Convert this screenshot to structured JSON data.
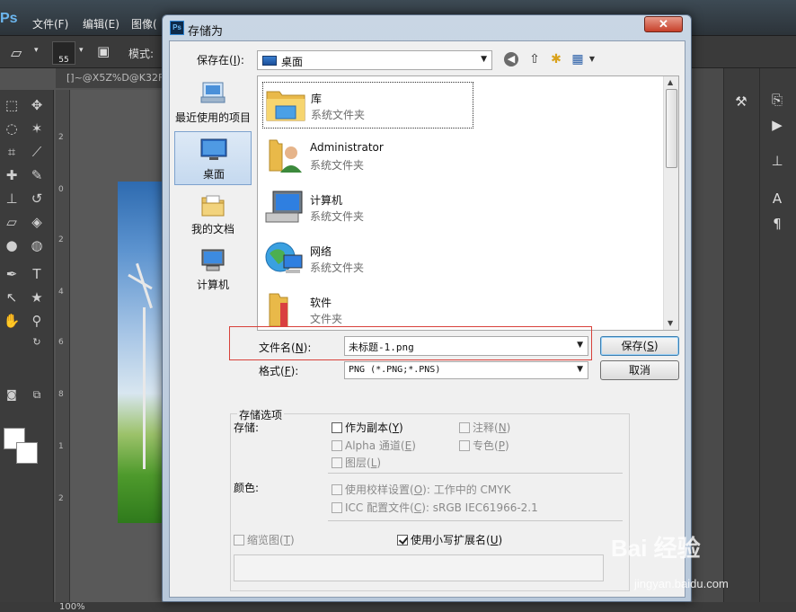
{
  "photoshop": {
    "logo": "Ps",
    "menu": [
      "文件(F)",
      "编辑(E)",
      "图像("
    ],
    "brush_size": "55",
    "mode_label": "模式:",
    "doc_tab": "[]~@X5Z%D@K32F",
    "ruler_numbers": [
      "2",
      "0",
      "2",
      "4",
      "6",
      "8",
      "1",
      "2"
    ],
    "status": "100%"
  },
  "dialog": {
    "title": "存储为",
    "close_glyph": "✕",
    "save_in_label": "保存在(I):",
    "save_in_label_prefix": "保存在(",
    "save_in_key": "I",
    "save_in_suffix": "):",
    "location": "桌面",
    "places": [
      {
        "label": "最近使用的项目",
        "icon": "recent-items-icon"
      },
      {
        "label": "桌面",
        "icon": "desktop-icon"
      },
      {
        "label": "我的文档",
        "icon": "documents-icon"
      },
      {
        "label": "计算机",
        "icon": "computer-icon"
      }
    ],
    "files": [
      {
        "name": "库",
        "type": "系统文件夹",
        "icon": "library-folder-icon"
      },
      {
        "name": "Administrator",
        "type": "系统文件夹",
        "icon": "user-folder-icon"
      },
      {
        "name": "计算机",
        "type": "系统文件夹",
        "icon": "computer-icon"
      },
      {
        "name": "网络",
        "type": "系统文件夹",
        "icon": "network-icon"
      },
      {
        "name": "软件",
        "type": "文件夹",
        "icon": "folder-icon"
      }
    ],
    "filename_label_prefix": "文件名(",
    "filename_key": "N",
    "filename_label_suffix": "):",
    "filename_value": "未标题-1.png",
    "format_label_prefix": "格式(",
    "format_key": "F",
    "format_label_suffix": "):",
    "format_value": "PNG (*.PNG;*.PNS)",
    "save_button_prefix": "保存(",
    "save_button_key": "S",
    "save_button_suffix": ")",
    "cancel_button": "取消",
    "options": {
      "legend": "存储选项",
      "storage_label": "存储:",
      "as_copy": {
        "text": "作为副本(",
        "key": "Y",
        "end": ")",
        "checked": false,
        "enabled": true
      },
      "annotations": {
        "text": "注释(",
        "key": "N",
        "end": ")",
        "checked": false,
        "enabled": false
      },
      "alpha": {
        "text": "Alpha 通道(",
        "key": "E",
        "end": ")",
        "checked": false,
        "enabled": false
      },
      "spot": {
        "text": "专色(",
        "key": "P",
        "end": ")",
        "checked": false,
        "enabled": false
      },
      "layers": {
        "text": "图层(",
        "key": "L",
        "end": ")",
        "checked": false,
        "enabled": false
      },
      "color_label": "颜色:",
      "proof": {
        "text": "使用校样设置(",
        "key": "O",
        "end": "):",
        "extra": "  工作中的 CMYK",
        "checked": false,
        "enabled": false
      },
      "icc": {
        "text": "ICC 配置文件(",
        "key": "C",
        "end": "):",
        "extra": "  sRGB IEC61966-2.1",
        "checked": false,
        "enabled": false
      },
      "thumbnail": {
        "text": "缩览图(",
        "key": "T",
        "end": ")",
        "checked": false,
        "enabled": false
      },
      "lowercase_ext": {
        "text": "使用小写扩展名(",
        "key": "U",
        "end": ")",
        "checked": true,
        "enabled": true
      }
    }
  },
  "watermark": {
    "logo": "Bai 经验",
    "url": "jingyan.baidu.com"
  },
  "colors": {
    "highlight": "#d8413a",
    "dialog_frame": "#b8c8da",
    "ps_bg": "#535353"
  }
}
